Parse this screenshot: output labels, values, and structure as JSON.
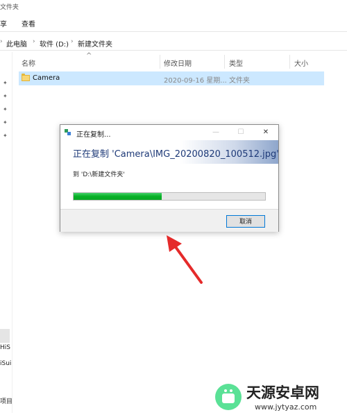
{
  "window": {
    "title_partial": "文件夹"
  },
  "menu": {
    "items": [
      "享",
      "查看"
    ]
  },
  "address": {
    "parts": [
      "此电脑",
      "软件 (D:)",
      "新建文件夹"
    ],
    "separator": "›"
  },
  "columns": {
    "name": "名称",
    "modified": "修改日期",
    "type": "类型",
    "size": "大小",
    "sort_indicator": "^"
  },
  "files": [
    {
      "name": "Camera",
      "modified": "2020-09-16 星期...",
      "type": "文件夹",
      "icon": "folder-icon"
    }
  ],
  "sidebar": {
    "pin_icon": "✦"
  },
  "bottom_left": {
    "items": [
      "HiS",
      "iSui",
      "项目"
    ]
  },
  "dialog": {
    "title": "正在复制...",
    "minimize": "—",
    "maximize": "☐",
    "close": "✕",
    "header": "正在复制 'Camera\\IMG_20200820_100512.jpg'",
    "destination": "到 'D:\\新建文件夹'",
    "progress_fraction": 0.46,
    "progress_color": "#06b025",
    "cancel_label": "取消"
  },
  "annotation": {
    "arrow_color": "#e52a2a"
  },
  "watermark": {
    "title": "天源安卓网",
    "url": "www.jytyaz.com"
  }
}
